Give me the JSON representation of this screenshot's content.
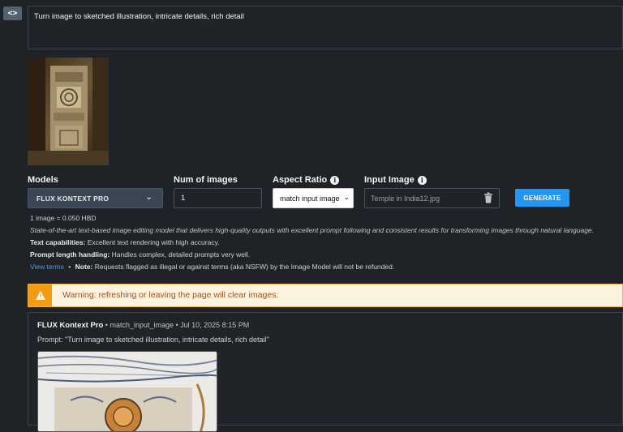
{
  "prompt": {
    "value": "Turn image to sketched illustration, intricate details, rich detail"
  },
  "form": {
    "models_label": "Models",
    "model_selected": "FLUX KONTEXT PRO",
    "num_images_label": "Num of images",
    "num_images_value": "1",
    "aspect_label": "Aspect Ratio",
    "aspect_selected": "match input image",
    "input_image_label": "Input Image",
    "input_image_filename": "Temple in India12.jpg",
    "generate_label": "GENERATE"
  },
  "info": {
    "cost": "1 image = 0.050 HBD",
    "description": "State-of-the-art text-based image editing model that delivers high-quality outputs with excellent prompt following and consistent results for transforming images through natural language.",
    "text_cap_label": "Text capabilities:",
    "text_cap_value": "Excellent text rendering with high accuracy.",
    "prompt_len_label": "Prompt length handling:",
    "prompt_len_value": "Handles complex, detailed prompts very well.",
    "view_terms": "View terms",
    "separator": "•",
    "note_label": "Note:",
    "note_value": "Requests flagged as illegal or against terms (aka NSFW) by the Image Model will not be refunded."
  },
  "warning": {
    "text": "Warning: refreshing or leaving the page will clear images."
  },
  "result": {
    "model": "FLUX Kontext Pro",
    "meta": "• match_input_image • Jul 10, 2025 8:15 PM",
    "prompt_line": "Prompt: \"Turn image to sketched illustration, intricate details, rich detail\""
  },
  "icons": {
    "toggle": "code-icon",
    "info": "info-icon",
    "chevron": "chevron-down-icon",
    "delete": "trash-icon",
    "warning": "warning-icon"
  },
  "colors": {
    "accent": "#2196f3",
    "warning": "#f39c12",
    "background": "#1f2226"
  }
}
